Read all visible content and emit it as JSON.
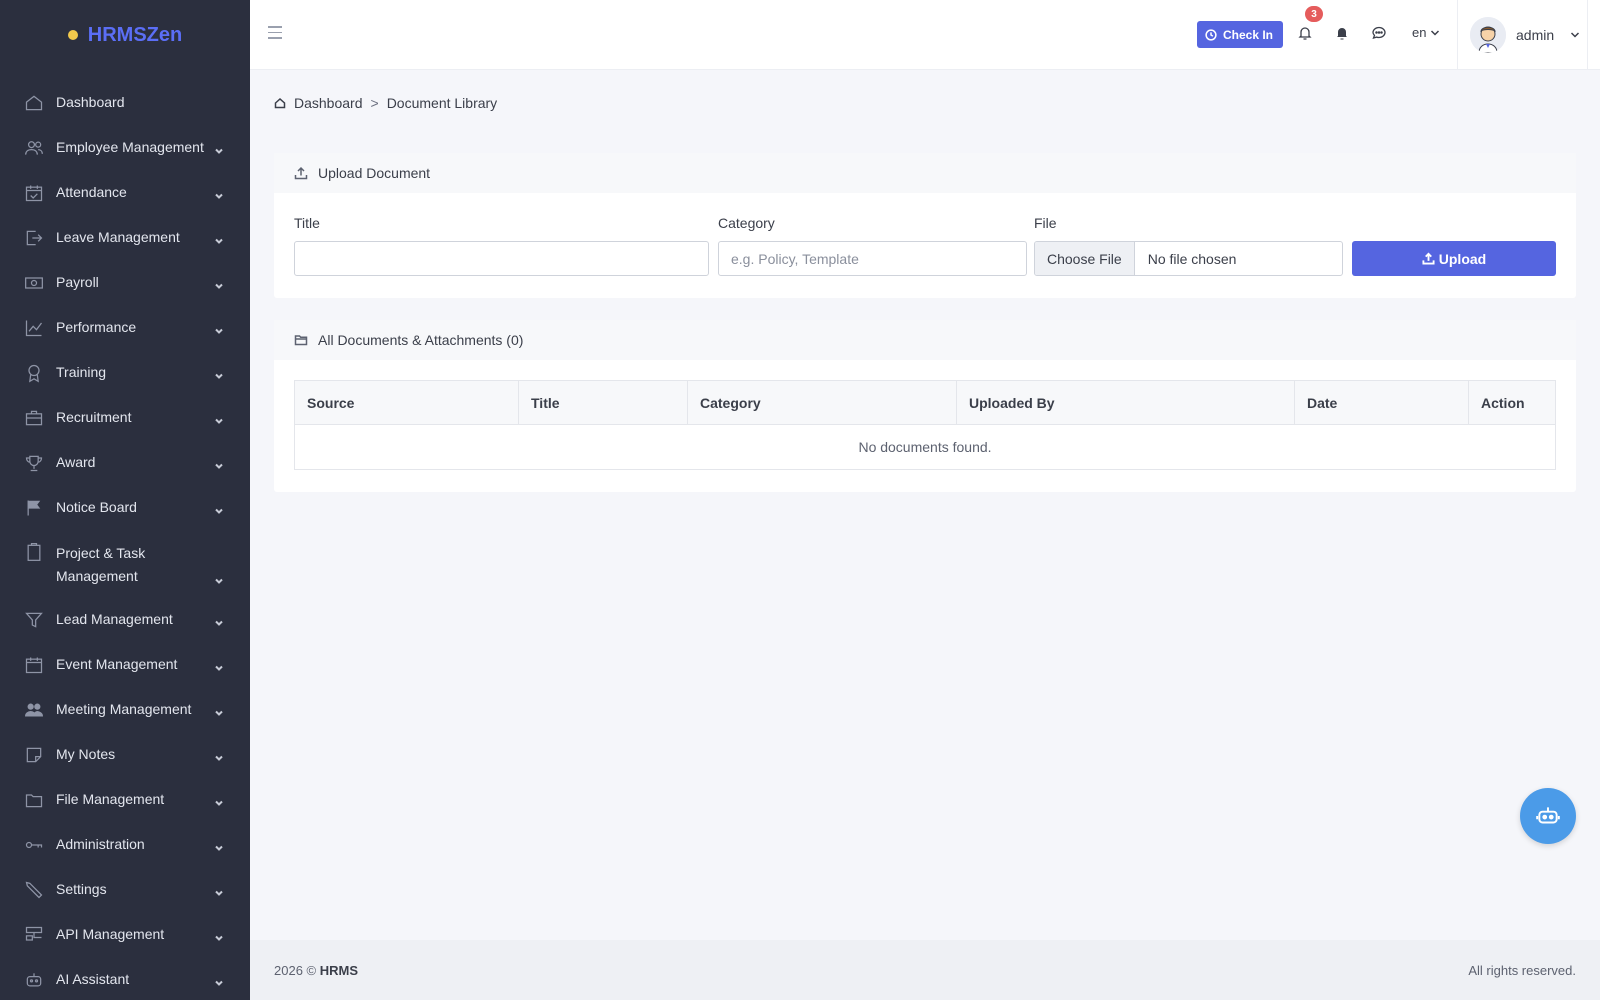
{
  "brand": {
    "name": "HRMSZen"
  },
  "sidebar": {
    "items": [
      {
        "label": "Dashboard",
        "icon": "home-icon",
        "chevron": false
      },
      {
        "label": "Employee Management",
        "icon": "users-icon",
        "chevron": true
      },
      {
        "label": "Attendance",
        "icon": "calendar-check-icon",
        "chevron": true
      },
      {
        "label": "Leave Management",
        "icon": "sign-out-icon",
        "chevron": true
      },
      {
        "label": "Payroll",
        "icon": "money-icon",
        "chevron": true
      },
      {
        "label": "Performance",
        "icon": "chart-line-icon",
        "chevron": true
      },
      {
        "label": "Training",
        "icon": "award-ribbon-icon",
        "chevron": true
      },
      {
        "label": "Recruitment",
        "icon": "briefcase-icon",
        "chevron": true
      },
      {
        "label": "Award",
        "icon": "trophy-icon",
        "chevron": true
      },
      {
        "label": "Notice Board",
        "icon": "flag-icon",
        "chevron": true
      },
      {
        "label": "Project & Task Management",
        "icon": "clipboard-icon",
        "chevron": true
      },
      {
        "label": "Lead Management",
        "icon": "funnel-icon",
        "chevron": true
      },
      {
        "label": "Event Management",
        "icon": "calendar-icon",
        "chevron": true
      },
      {
        "label": "Meeting Management",
        "icon": "people-icon",
        "chevron": true
      },
      {
        "label": "My Notes",
        "icon": "sticky-note-icon",
        "chevron": true
      },
      {
        "label": "File Management",
        "icon": "folder-icon",
        "chevron": true
      },
      {
        "label": "Administration",
        "icon": "key-icon",
        "chevron": true
      },
      {
        "label": "Settings",
        "icon": "wrench-icon",
        "chevron": true
      },
      {
        "label": "API Management",
        "icon": "network-icon",
        "chevron": true
      },
      {
        "label": "AI Assistant",
        "icon": "robot-icon",
        "chevron": true
      }
    ]
  },
  "topbar": {
    "checkin_label": "Check In",
    "notification_count": "3",
    "language": "en",
    "user_name": "admin"
  },
  "breadcrumb": {
    "home": "Dashboard",
    "separator": ">",
    "current": "Document Library"
  },
  "upload": {
    "heading": "Upload Document",
    "title_label": "Title",
    "title_value": "",
    "category_label": "Category",
    "category_placeholder": "e.g. Policy, Template",
    "file_label": "File",
    "choose_file": "Choose File",
    "no_file": "No file chosen",
    "upload_button": "Upload"
  },
  "documents": {
    "heading": "All Documents & Attachments (0)",
    "columns": [
      "Source",
      "Title",
      "Category",
      "Uploaded By",
      "Date",
      "Action"
    ],
    "empty_message": "No documents found."
  },
  "footer": {
    "year": "2026 ©",
    "company": "HRMS",
    "rights": "All rights reserved."
  },
  "colors": {
    "sidebar_bg": "#2b2f3e",
    "accent": "#5565e0",
    "brand": "#5b6ef5",
    "badge": "#e55c5c",
    "fab": "#4b9be8"
  }
}
